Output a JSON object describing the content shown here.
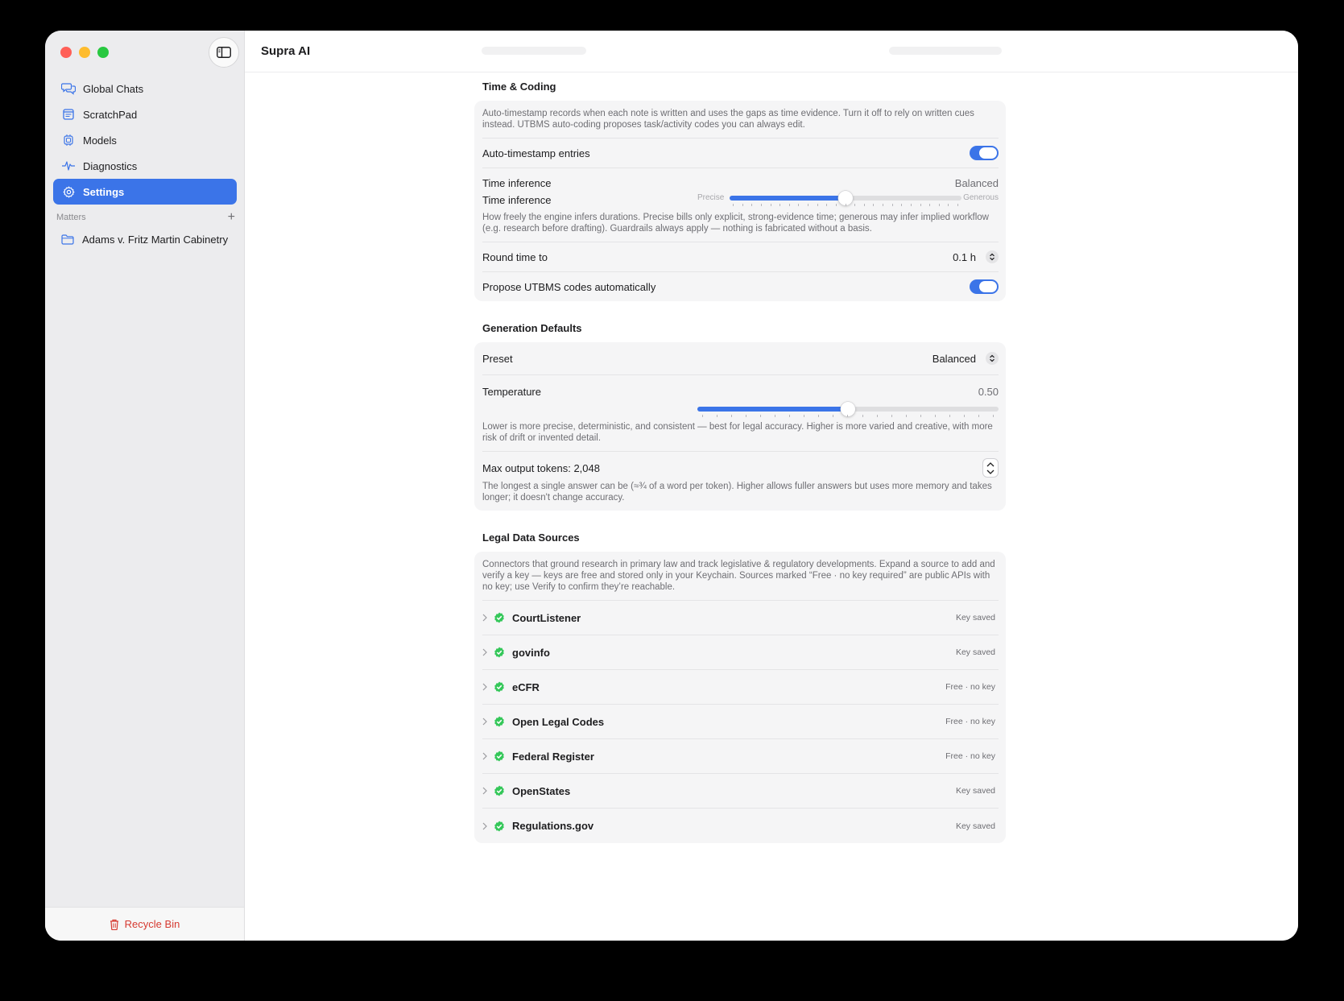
{
  "app": {
    "title": "Supra AI"
  },
  "sidebar": {
    "items": [
      {
        "label": "Global Chats",
        "icon": "chat-bubbles-icon"
      },
      {
        "label": "ScratchPad",
        "icon": "notepad-icon"
      },
      {
        "label": "Models",
        "icon": "chip-icon"
      },
      {
        "label": "Diagnostics",
        "icon": "waveform-icon"
      },
      {
        "label": "Settings",
        "icon": "gear-icon",
        "active": true
      }
    ],
    "matters_heading": "Matters",
    "matters": [
      {
        "label": "Adams v. Fritz Martin Cabinetry"
      }
    ],
    "footer_label": "Recycle Bin"
  },
  "time_coding": {
    "title": "Time & Coding",
    "description": "Auto-timestamp records when each note is written and uses the gaps as time evidence. Turn it off to rely on written cues instead. UTBMS auto-coding proposes task/activity codes you can always edit.",
    "auto_timestamp": {
      "label": "Auto-timestamp entries",
      "on": true
    },
    "time_inference": {
      "label": "Time inference",
      "value": "Balanced",
      "slider_label": "Time inference",
      "min_label": "Precise",
      "max_label": "Generous",
      "level": 0.5,
      "description": "How freely the engine infers durations. Precise bills only explicit, strong-evidence time; generous may infer implied workflow (e.g. research before drafting). Guardrails always apply — nothing is fabricated without a basis."
    },
    "round_time": {
      "label": "Round time to",
      "value": "0.1 h"
    },
    "utbms": {
      "label": "Propose UTBMS codes automatically",
      "on": true
    }
  },
  "generation": {
    "title": "Generation Defaults",
    "preset": {
      "label": "Preset",
      "value": "Balanced"
    },
    "temperature": {
      "label": "Temperature",
      "value": "0.50",
      "level": 0.5,
      "description": "Lower is more precise, deterministic, and consistent — best for legal accuracy. Higher is more varied and creative, with more risk of drift or invented detail."
    },
    "max_tokens": {
      "label": "Max output tokens: 2,048",
      "description": "The longest a single answer can be (≈¾ of a word per token). Higher allows fuller answers but uses more memory and takes longer; it doesn't change accuracy."
    }
  },
  "sources": {
    "title": "Legal Data Sources",
    "description": "Connectors that ground research in primary law and track legislative & regulatory developments. Expand a source to add and verify a key — keys are free and stored only in your Keychain. Sources marked “Free · no key required” are public APIs with no key; use Verify to confirm they’re reachable.",
    "items": [
      {
        "name": "CourtListener",
        "status": "Key saved"
      },
      {
        "name": "govinfo",
        "status": "Key saved"
      },
      {
        "name": "eCFR",
        "status": "Free · no key"
      },
      {
        "name": "Open Legal Codes",
        "status": "Free · no key"
      },
      {
        "name": "Federal Register",
        "status": "Free · no key"
      },
      {
        "name": "OpenStates",
        "status": "Key saved"
      },
      {
        "name": "Regulations.gov",
        "status": "Key saved"
      }
    ]
  },
  "colors": {
    "accent": "#3b74e8",
    "success": "#34c759",
    "danger": "#d63a31"
  }
}
